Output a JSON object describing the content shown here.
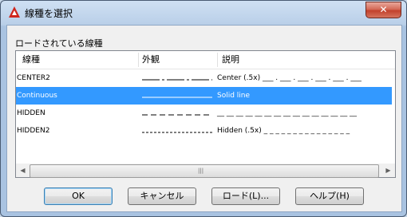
{
  "window": {
    "title": "線種を選択"
  },
  "section_label": "ロードされている線種",
  "columns": [
    "線種",
    "外観",
    "説明"
  ],
  "linetypes": [
    {
      "name": "CENTER2",
      "description": "Center (.5x) ___ . ___ . ___ . ___ . ___ . ___",
      "pattern": "center",
      "selected": false
    },
    {
      "name": "Continuous",
      "description": "Solid line",
      "pattern": "continuous",
      "selected": true
    },
    {
      "name": "HIDDEN",
      "description": "__ __ __ __ __ __ __ __ __ __ __ __ __ __ __",
      "pattern": "hidden",
      "selected": false
    },
    {
      "name": "HIDDEN2",
      "description": "Hidden (.5x) _ _ _ _ _ _ _ _ _ _ _ _ _ _ _",
      "pattern": "hidden2",
      "selected": false
    }
  ],
  "buttons": {
    "ok": "OK",
    "cancel": "キャンセル",
    "load": "ロード(L)...",
    "help": "ヘルプ(H)"
  },
  "icons": {
    "app": "autocad-icon",
    "close": "close-icon",
    "scroll_left": "arrow-left-icon",
    "scroll_right": "arrow-right-icon",
    "grip": "grip-icon"
  },
  "colors": {
    "selection": "#3399ff",
    "close_button": "#c2412c",
    "app_icon": "#d0261c"
  }
}
